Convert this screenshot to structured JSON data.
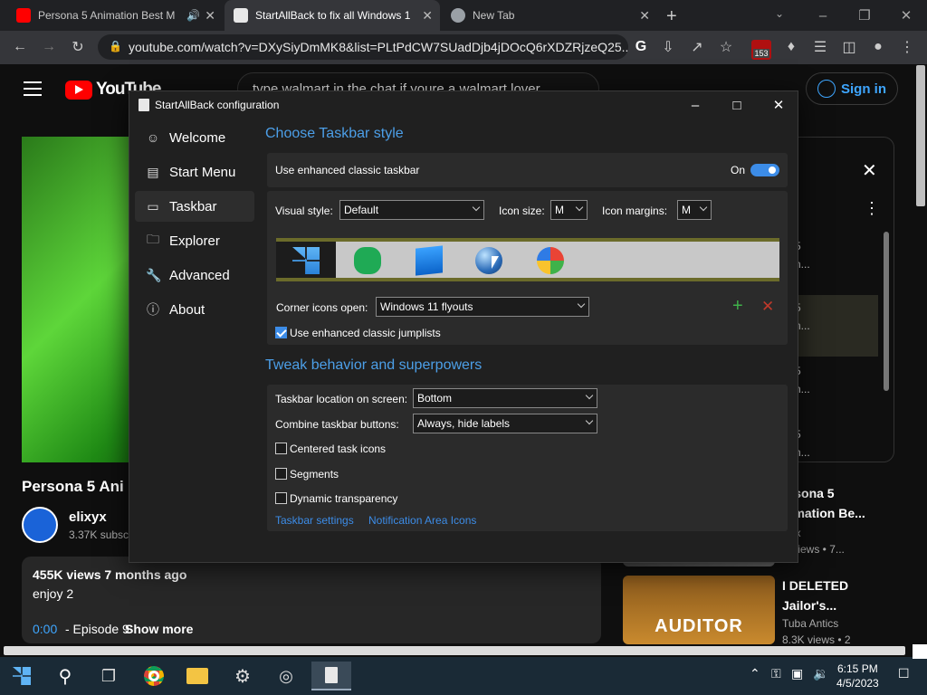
{
  "browser": {
    "tabs": [
      {
        "title": "Persona 5 Animation Best M",
        "favicon_color": "#ff0000",
        "audio": true
      },
      {
        "title": "StartAllBack to fix all Windows 1",
        "favicon_color": "#e8e8e8"
      },
      {
        "title": "New Tab",
        "favicon_color": "#9aa0a6"
      }
    ],
    "url": "youtube.com/watch?v=DXySiyDmMK8&list=PLtPdCW7SUadDjb4jDOcQ6rXDZRjzeQ25...",
    "extension_badge": "153"
  },
  "youtube": {
    "logo_text": "YouTube",
    "search_text": "type walmart in the chat if youre a walmart lover",
    "signin_label": "Sign in",
    "video_title": "Persona 5 Ani",
    "channel_name": "elixyx",
    "channel_subs": "3.37K subsc",
    "views": "455K views  7 months ago",
    "description": "enjoy 2",
    "desc_timestamp": "0:00",
    "desc_episode": "- Episode 9",
    "show_more": "Show more",
    "recommendations": [
      {
        "title1": "ersona 5",
        "title2": "nimation Be...",
        "meta1": "ixyx",
        "meta2": "K views • 7..."
      },
      {
        "title1": "I DELETED",
        "title2": "Jailor's...",
        "meta1": "Tuba Antics",
        "meta2": "8.3K views • 2",
        "thumb_text": "AUDITOR"
      }
    ],
    "panel_snippets": [
      "5",
      "n...",
      "5",
      "n...",
      "5",
      "n...",
      "5",
      "n..."
    ]
  },
  "dialog": {
    "title": "StartAllBack configuration",
    "nav": [
      {
        "label": "Welcome",
        "icon": "smile-icon"
      },
      {
        "label": "Start Menu",
        "icon": "start-menu-icon"
      },
      {
        "label": "Taskbar",
        "icon": "taskbar-icon",
        "selected": true
      },
      {
        "label": "Explorer",
        "icon": "folder-icon"
      },
      {
        "label": "Advanced",
        "icon": "wrench-icon"
      },
      {
        "label": "About",
        "icon": "info-icon"
      }
    ],
    "section1_title": "Choose Taskbar style",
    "enhanced_label": "Use enhanced classic taskbar",
    "toggle_label": "On",
    "visual_style_label": "Visual style:",
    "visual_style_value": "Default",
    "icon_size_label": "Icon size:",
    "icon_size_value": "M",
    "icon_margins_label": "Icon margins:",
    "icon_margins_value": "M",
    "corner_label": "Corner icons open:",
    "corner_value": "Windows 11 flyouts",
    "jumplists_label": "Use enhanced classic jumplists",
    "jumplists_checked": true,
    "section2_title": "Tweak behavior and superpowers",
    "location_label": "Taskbar location on screen:",
    "location_value": "Bottom",
    "combine_label": "Combine taskbar buttons:",
    "combine_value": "Always, hide labels",
    "checkboxes": [
      {
        "label": "Centered task icons",
        "checked": false
      },
      {
        "label": "Segments",
        "checked": false
      },
      {
        "label": "Dynamic transparency",
        "checked": false
      }
    ],
    "link1": "Taskbar settings",
    "link2": "Notification Area Icons"
  },
  "taskbar": {
    "time": "6:15 PM",
    "date": "4/5/2023"
  },
  "colors": {
    "accent": "#3c8ce7",
    "section": "#4c9fe8",
    "youtube_red": "#ff0000",
    "link": "#3ea6ff"
  }
}
